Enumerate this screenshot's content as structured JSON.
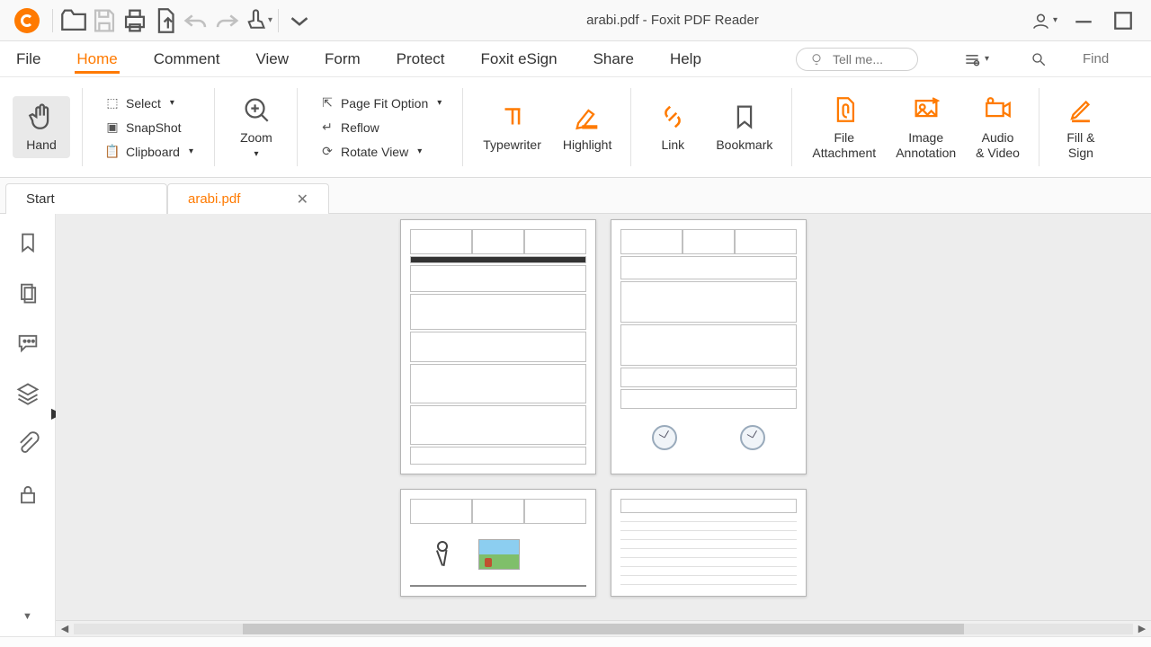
{
  "app": {
    "title": "arabi.pdf - Foxit PDF Reader"
  },
  "menu": {
    "file": "File",
    "home": "Home",
    "comment": "Comment",
    "view": "View",
    "form": "Form",
    "protect": "Protect",
    "esign": "Foxit eSign",
    "share": "Share",
    "help": "Help",
    "tellme_placeholder": "Tell me...",
    "find_placeholder": "Find"
  },
  "ribbon": {
    "hand": "Hand",
    "select": "Select",
    "snapshot": "SnapShot",
    "clipboard": "Clipboard",
    "zoom": "Zoom",
    "pagefit": "Page Fit Option",
    "reflow": "Reflow",
    "rotate": "Rotate View",
    "typewriter": "Typewriter",
    "highlight": "Highlight",
    "link": "Link",
    "bookmark": "Bookmark",
    "fileatt": "File\nAttachment",
    "imganno": "Image\nAnnotation",
    "av": "Audio\n& Video",
    "fillsign": "Fill &\nSign"
  },
  "tabs": {
    "start": "Start",
    "doc": "arabi.pdf"
  }
}
